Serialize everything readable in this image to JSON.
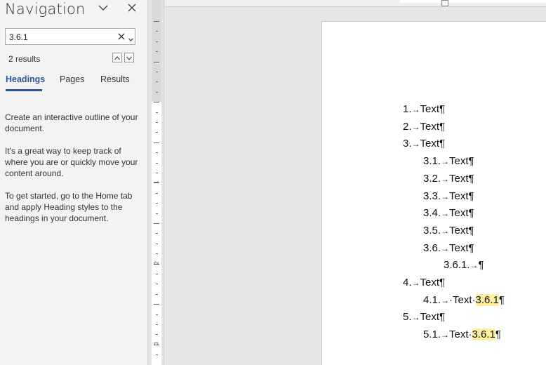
{
  "nav": {
    "title": "Navigation",
    "search_value": "3.6.1",
    "results_count": "2 results",
    "tabs": [
      "Headings",
      "Pages",
      "Results"
    ],
    "para1": "Create an interactive outline of your document.",
    "para2": "It's a great way to keep track of where you are or quickly move your content around.",
    "para3": "To get started, go to the Home tab and apply Heading styles to the headings in your document."
  },
  "ruler": {
    "numbers": [
      "1",
      "2",
      "3"
    ]
  },
  "document": {
    "lines": [
      {
        "num": "1.",
        "text": "Text",
        "mark": "¶",
        "level": 1,
        "hl": ""
      },
      {
        "num": "2.",
        "text": "Text",
        "mark": "¶",
        "level": 1,
        "hl": ""
      },
      {
        "num": "3.",
        "text": "Text",
        "mark": "¶",
        "level": 1,
        "hl": ""
      },
      {
        "num": "3.1.",
        "text": "Text",
        "mark": "¶",
        "level": 2,
        "hl": ""
      },
      {
        "num": "3.2.",
        "text": "Text",
        "mark": "¶",
        "level": 2,
        "hl": ""
      },
      {
        "num": "3.3.",
        "text": "Text",
        "mark": "¶",
        "level": 2,
        "hl": ""
      },
      {
        "num": "3.4.",
        "text": "Text",
        "mark": "¶",
        "level": 2,
        "hl": ""
      },
      {
        "num": "3.5.",
        "text": "Text",
        "mark": "¶",
        "level": 2,
        "hl": ""
      },
      {
        "num": "3.6.",
        "text": "Text",
        "mark": "¶",
        "level": 2,
        "hl": ""
      },
      {
        "num": "3.6.1.",
        "text": "",
        "mark": "¶",
        "level": 3,
        "hl": ""
      },
      {
        "num": "4.",
        "text": "Text",
        "mark": "¶",
        "level": 1,
        "hl": ""
      },
      {
        "num": "4.1.",
        "text": "·Text·",
        "mark": "¶",
        "level": 2,
        "hl": "3.6.1"
      },
      {
        "num": "5.",
        "text": "Text",
        "mark": "¶",
        "level": 1,
        "hl": ""
      },
      {
        "num": "5.1.",
        "text": "Text·",
        "mark": "¶",
        "level": 2,
        "hl": "3.6.1"
      }
    ]
  }
}
